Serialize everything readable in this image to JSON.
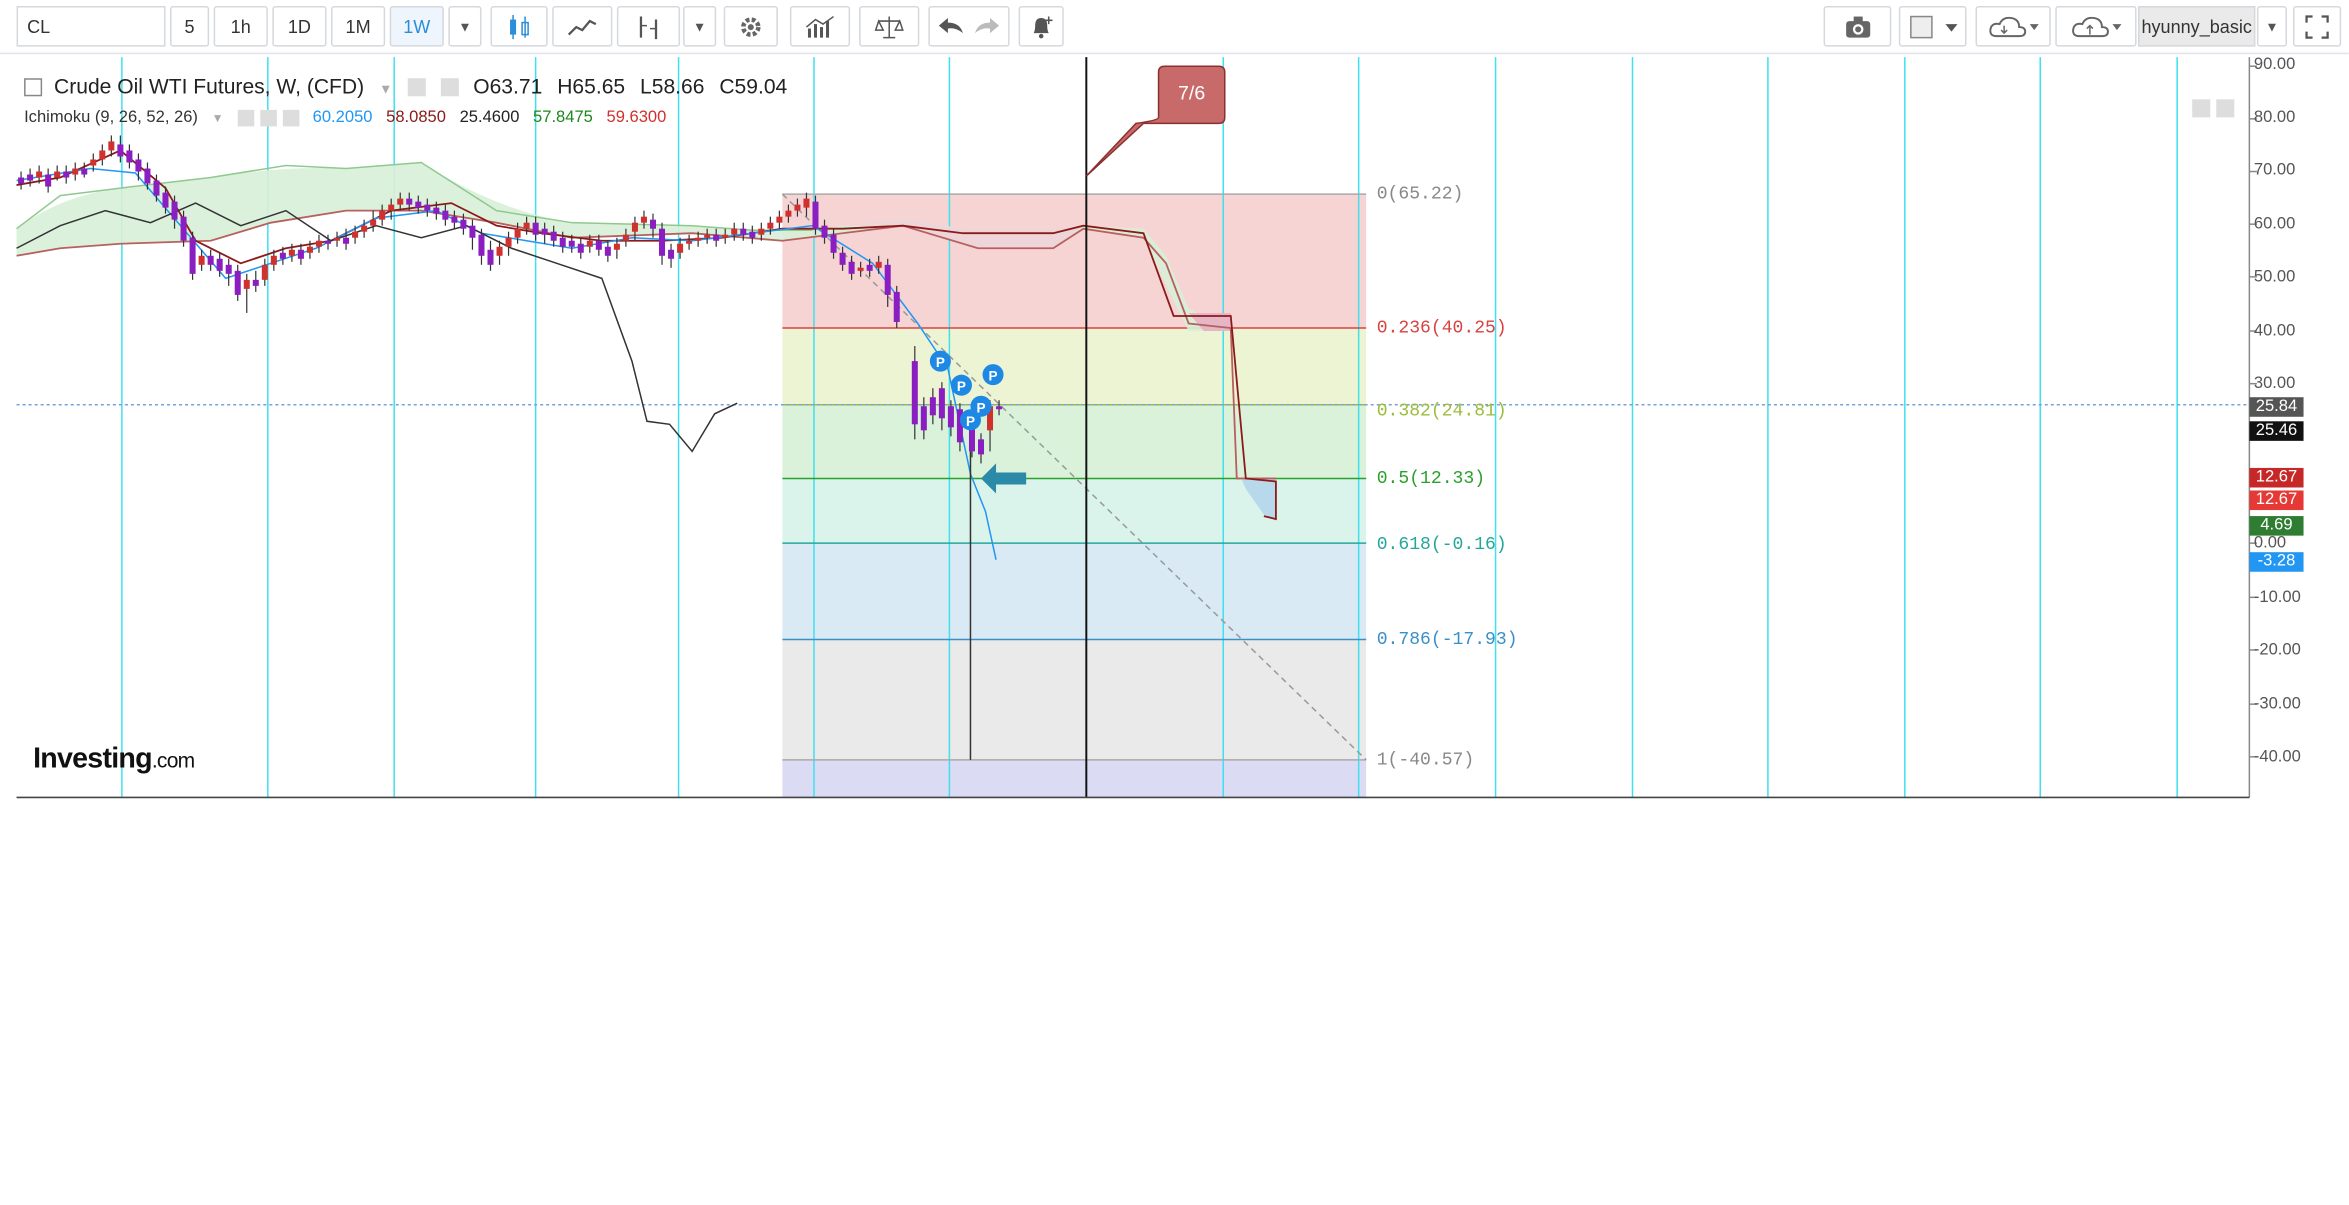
{
  "toolbar": {
    "symbol": "CL",
    "intervals": [
      "5",
      "1h",
      "1D",
      "1M",
      "1W"
    ],
    "active_interval": "1W",
    "user": "hyunny_basic"
  },
  "legend": {
    "title": "Crude Oil WTI Futures, W, (CFD)",
    "open": "O63.71",
    "high": "H65.65",
    "low": "L58.66",
    "close": "C59.04",
    "indicator_name": "Ichimoku (9, 26, 52, 26)",
    "ind_values": [
      "60.2050",
      "58.0850",
      "25.4600",
      "57.8475",
      "59.6300"
    ],
    "ind_colors": [
      "#2196f3",
      "#8b1a1a",
      "#222222",
      "#1a8a1a",
      "#d0312d"
    ]
  },
  "y_axis": {
    "ticks": [
      "90.00",
      "80.00",
      "70.00",
      "60.00",
      "50.00",
      "40.00",
      "30.00",
      "0.00",
      "-10.00",
      "-20.00",
      "-30.00",
      "-40.00"
    ]
  },
  "price_tags": [
    {
      "value": "25.84",
      "color": "#555555"
    },
    {
      "value": "25.46",
      "color": "#111111"
    },
    {
      "value": "12.67",
      "color": "#c62828"
    },
    {
      "value": "12.67",
      "color": "#e53935"
    },
    {
      "value": "4.69",
      "color": "#2e7d32"
    },
    {
      "value": "-3.28",
      "color": "#2196f3"
    }
  ],
  "fib_levels": [
    {
      "label": "0(65.22)",
      "color": "#888888"
    },
    {
      "label": "0.236(40.25)",
      "color": "#d84343"
    },
    {
      "label": "0.382(24.81)",
      "color": "#9bbd3a"
    },
    {
      "label": "0.5(12.33)",
      "color": "#2ca02c"
    },
    {
      "label": "0.618(-0.16)",
      "color": "#26a69a"
    },
    {
      "label": "0.786(-17.93)",
      "color": "#3b8fc8"
    },
    {
      "label": "1(-40.57)",
      "color": "#888888"
    }
  ],
  "callout": {
    "label": "7/6"
  },
  "position_marker": "P",
  "logo": {
    "main": "Investing",
    "suffix": ".com"
  },
  "colors": {
    "fib_0_236": "#f4cccc",
    "fib_236_382": "#eaf2cc",
    "fib_382_5": "#d4f0d4",
    "fib_5_618": "#d3f2e8",
    "fib_618_786": "#d3e6f2",
    "fib_786_1": "#e6e6e6",
    "fib_below": "#d5d5f2",
    "candle_up": "#d0312d",
    "candle_down": "#8a1ec0",
    "grid_cyan": "#3fe0f0",
    "callout": "#c86a6a"
  }
}
